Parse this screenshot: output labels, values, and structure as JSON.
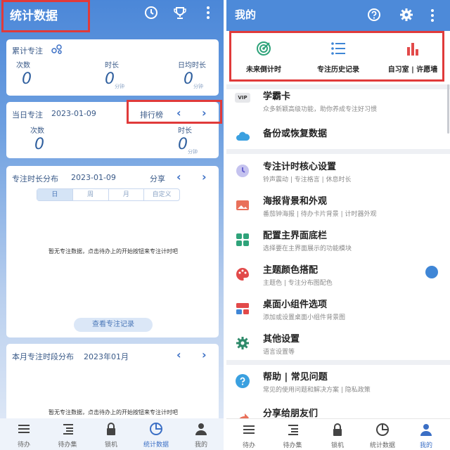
{
  "left": {
    "title": "统计数据",
    "total_card": {
      "title": "累计专注",
      "labels": [
        "次数",
        "时长",
        "日均时长"
      ],
      "values": [
        "0",
        "0",
        "0"
      ],
      "units": [
        "",
        "分钟",
        "分钟"
      ]
    },
    "today_card": {
      "title": "当日专注",
      "date": "2023-01-09",
      "ranking": "排行榜",
      "labels": [
        "次数",
        "时长"
      ],
      "values": [
        "0",
        "0"
      ],
      "unit": "分钟"
    },
    "distribution_card": {
      "title": "专注时长分布",
      "date": "2023-01-09",
      "share": "分享",
      "tabs": [
        "日",
        "周",
        "月",
        "自定义"
      ],
      "empty_text": "暂无专注数据，点击待办上的开始按钮来专注计时吧",
      "records_button": "查看专注记录"
    },
    "month_card": {
      "title": "本月专注时段分布",
      "date": "2023年01月",
      "empty_text": "暂无专注数据，点击待办上的开始按钮来专注计时吧"
    },
    "bottom_nav": [
      "待办",
      "待办集",
      "锁机",
      "统计数据",
      "我的"
    ]
  },
  "right": {
    "title": "我的",
    "shortcuts": [
      "未来倒计时",
      "专注历史记录",
      "自习室 | 许愿墙"
    ],
    "vip_label": "VIP",
    "rows": [
      {
        "title": "学霸卡",
        "sub": "众多新颖高级功能，助你养成专注好习惯"
      },
      {
        "title": "备份或恢复数据",
        "sub": ""
      },
      {
        "title": "专注计时核心设置",
        "sub": "铃声震动 | 专注格言 | 休息时长"
      },
      {
        "title": "海报背景和外观",
        "sub": "番茄钟海报 | 待办卡片背景 | 计时器外观"
      },
      {
        "title": "配置主界面底栏",
        "sub": "选择要在主界面展示的功能模块"
      },
      {
        "title": "主题颜色搭配",
        "sub": "主题色 | 专注分布图配色"
      },
      {
        "title": "桌面小组件选项",
        "sub": "添加或设置桌面小组件背景图"
      },
      {
        "title": "其他设置",
        "sub": "语言设置等"
      },
      {
        "title": "帮助 | 常见问题",
        "sub": "常见的使用问题和解决方案 | 隐私政策"
      },
      {
        "title": "分享给朋友们",
        "sub": ""
      }
    ],
    "bottom_nav": [
      "待办",
      "待办集",
      "锁机",
      "统计数据",
      "我的"
    ]
  },
  "colors": {
    "accent": "#4d8ad9",
    "highlight": "#e03a3a",
    "theme_dot": "#3f86d6"
  }
}
